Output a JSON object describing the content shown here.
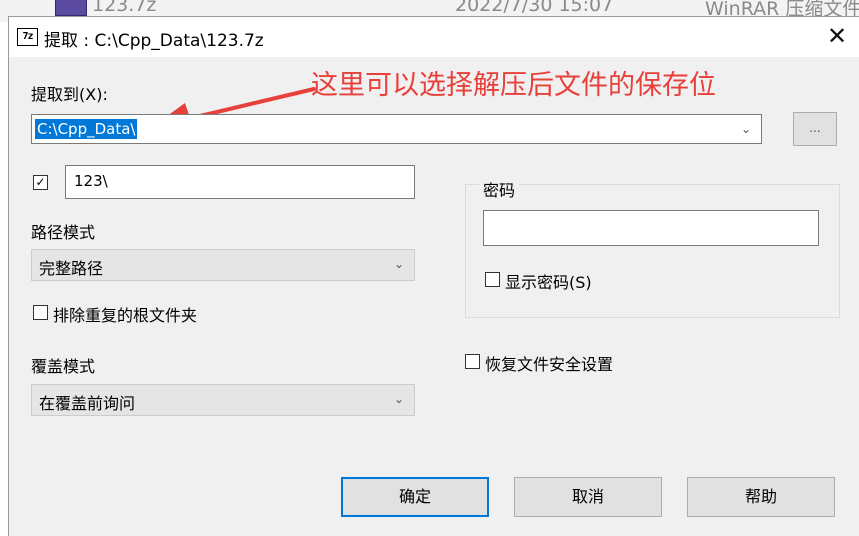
{
  "background_row": {
    "name": "123.7z",
    "date": "2022/7/30 15:07",
    "type": "WinRAR 压缩文件"
  },
  "dialog": {
    "title": "提取 : C:\\Cpp_Data\\123.7z",
    "app_icon": "7z",
    "close_glyph": "✕"
  },
  "annotation": {
    "text": "这里可以选择解压后文件的保存位",
    "color": "#e8403a"
  },
  "extract_to": {
    "label": "提取到(X):",
    "value": "C:\\Cpp_Data\\",
    "browse_label": "..."
  },
  "subfolder": {
    "checked": true,
    "check_glyph": "✓",
    "value": "123\\"
  },
  "path_mode": {
    "label": "路径模式",
    "value": "完整路径"
  },
  "exclude_duplicate_root": {
    "label": "排除重复的根文件夹",
    "checked": false
  },
  "overwrite_mode": {
    "label": "覆盖模式",
    "value": "在覆盖前询问"
  },
  "password": {
    "group_label": "密码",
    "value": "",
    "show_password_label": "显示密码(S)",
    "show_password_checked": false
  },
  "restore_security": {
    "label": "恢复文件安全设置",
    "checked": false
  },
  "buttons": {
    "ok": "确定",
    "cancel": "取消",
    "help": "帮助"
  },
  "colors": {
    "selection": "#0078d7",
    "default_button_border": "#0078d7"
  }
}
